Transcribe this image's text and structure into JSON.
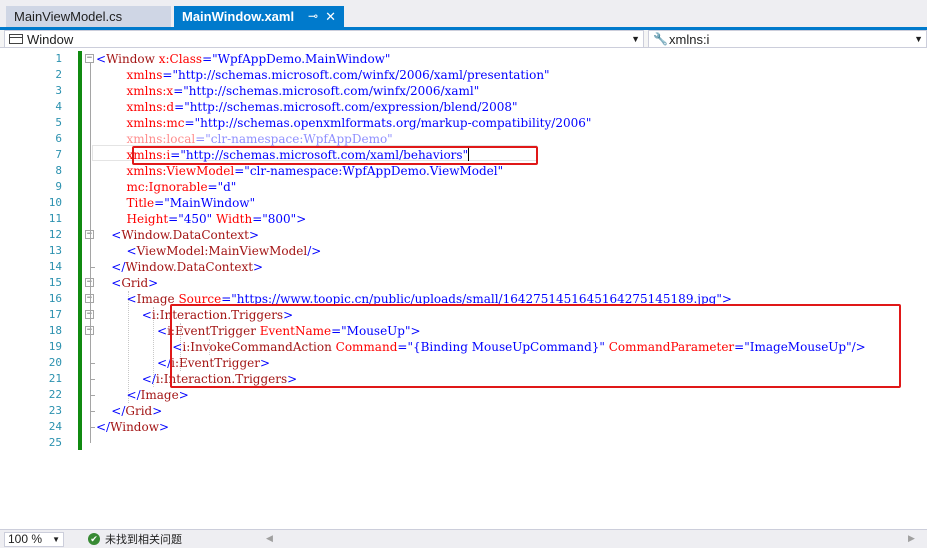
{
  "tabs": [
    {
      "label": "MainViewModel.cs",
      "active": false
    },
    {
      "label": "MainWindow.xaml",
      "active": true,
      "pin_icon": "pin-icon",
      "close_icon": "close-icon"
    }
  ],
  "tab_pin_glyph": "⊸",
  "tab_close_glyph": "✕",
  "navbar": {
    "left_value": "Window",
    "right_value": "xmlns:i",
    "left_icon": "class-icon",
    "right_icon": "wrench-icon",
    "dropdown_glyph": "▼"
  },
  "code_lines": [
    [
      [
        "p",
        "<"
      ],
      [
        "e",
        "Window "
      ],
      [
        "a",
        "x:Class"
      ],
      [
        "p",
        "="
      ],
      [
        "v",
        "\"WpfAppDemo.MainWindow\""
      ]
    ],
    [
      [
        "s",
        "        "
      ],
      [
        "a",
        "xmlns"
      ],
      [
        "p",
        "="
      ],
      [
        "v",
        "\"http://schemas.microsoft.com/winfx/2006/xaml/presentation\""
      ]
    ],
    [
      [
        "s",
        "        "
      ],
      [
        "a",
        "xmlns:x"
      ],
      [
        "p",
        "="
      ],
      [
        "v",
        "\"http://schemas.microsoft.com/winfx/2006/xaml\""
      ]
    ],
    [
      [
        "s",
        "        "
      ],
      [
        "a",
        "xmlns:d"
      ],
      [
        "p",
        "="
      ],
      [
        "v",
        "\"http://schemas.microsoft.com/expression/blend/2008\""
      ]
    ],
    [
      [
        "s",
        "        "
      ],
      [
        "a",
        "xmlns:mc"
      ],
      [
        "p",
        "="
      ],
      [
        "v",
        "\"http://schemas.openxmlformats.org/markup-compatibility/2006\""
      ]
    ],
    [
      [
        "s",
        "        "
      ],
      [
        "fa",
        "xmlns:local"
      ],
      [
        "fp",
        "="
      ],
      [
        "fv",
        "\"clr-namespace:WpfAppDemo\""
      ]
    ],
    [
      [
        "s",
        "        "
      ],
      [
        "a",
        "xmlns:i"
      ],
      [
        "p",
        "="
      ],
      [
        "v",
        "\"http://schemas.microsoft.com/xaml/behaviors\""
      ],
      [
        "c",
        ""
      ]
    ],
    [
      [
        "s",
        "        "
      ],
      [
        "a",
        "xmlns:ViewModel"
      ],
      [
        "p",
        "="
      ],
      [
        "v",
        "\"clr-namespace:WpfAppDemo.ViewModel\""
      ]
    ],
    [
      [
        "s",
        "        "
      ],
      [
        "a",
        "mc:Ignorable"
      ],
      [
        "p",
        "="
      ],
      [
        "v",
        "\"d\""
      ]
    ],
    [
      [
        "s",
        "        "
      ],
      [
        "a",
        "Title"
      ],
      [
        "p",
        "="
      ],
      [
        "v",
        "\"MainWindow\""
      ]
    ],
    [
      [
        "s",
        "        "
      ],
      [
        "a",
        "Height"
      ],
      [
        "p",
        "="
      ],
      [
        "v",
        "\"450\" "
      ],
      [
        "a",
        "Width"
      ],
      [
        "p",
        "="
      ],
      [
        "v",
        "\"800\""
      ],
      [
        "p",
        ">"
      ]
    ],
    [
      [
        "s",
        "    "
      ],
      [
        "p",
        "<"
      ],
      [
        "e",
        "Window.DataContext"
      ],
      [
        "p",
        ">"
      ]
    ],
    [
      [
        "s",
        "        "
      ],
      [
        "p",
        "<"
      ],
      [
        "e",
        "ViewModel:MainViewModel"
      ],
      [
        "p",
        "/>"
      ]
    ],
    [
      [
        "s",
        "    "
      ],
      [
        "p",
        "</"
      ],
      [
        "e",
        "Window.DataContext"
      ],
      [
        "p",
        ">"
      ]
    ],
    [
      [
        "s",
        "    "
      ],
      [
        "p",
        "<"
      ],
      [
        "e",
        "Grid"
      ],
      [
        "p",
        ">"
      ]
    ],
    [
      [
        "s",
        "        "
      ],
      [
        "p",
        "<"
      ],
      [
        "e",
        "Image "
      ],
      [
        "a",
        "Source"
      ],
      [
        "p",
        "="
      ],
      [
        "v",
        "\"https://www.toopic.cn/public/uploads/small/1642751451645164275145189.jpg\""
      ],
      [
        "p",
        ">"
      ]
    ],
    [
      [
        "s",
        "            "
      ],
      [
        "p",
        "<"
      ],
      [
        "e",
        "i:Interaction.Triggers"
      ],
      [
        "p",
        ">"
      ]
    ],
    [
      [
        "s",
        "                "
      ],
      [
        "p",
        "<"
      ],
      [
        "e",
        "i:EventTrigger "
      ],
      [
        "a",
        "EventName"
      ],
      [
        "p",
        "="
      ],
      [
        "v",
        "\"MouseUp\""
      ],
      [
        "p",
        ">"
      ]
    ],
    [
      [
        "s",
        "                    "
      ],
      [
        "p",
        "<"
      ],
      [
        "e",
        "i:InvokeCommandAction "
      ],
      [
        "a",
        "Command"
      ],
      [
        "p",
        "="
      ],
      [
        "v",
        "\"{Binding MouseUpCommand}\" "
      ],
      [
        "a",
        "CommandParameter"
      ],
      [
        "p",
        "="
      ],
      [
        "v",
        "\"ImageMouseUp\""
      ],
      [
        "p",
        "/>"
      ]
    ],
    [
      [
        "s",
        "                "
      ],
      [
        "p",
        "</"
      ],
      [
        "e",
        "i:EventTrigger"
      ],
      [
        "p",
        ">"
      ]
    ],
    [
      [
        "s",
        "            "
      ],
      [
        "p",
        "</"
      ],
      [
        "e",
        "i:Interaction.Triggers"
      ],
      [
        "p",
        ">"
      ]
    ],
    [
      [
        "s",
        "        "
      ],
      [
        "p",
        "</"
      ],
      [
        "e",
        "Image"
      ],
      [
        "p",
        ">"
      ]
    ],
    [
      [
        "s",
        "    "
      ],
      [
        "p",
        "</"
      ],
      [
        "e",
        "Grid"
      ],
      [
        "p",
        ">"
      ]
    ],
    [
      [
        "p",
        "</"
      ],
      [
        "e",
        "Window"
      ],
      [
        "p",
        ">"
      ]
    ],
    []
  ],
  "status": {
    "zoom": "100 %",
    "issues_text": "未找到相关问题",
    "issues_icon": "check-circle-icon",
    "check_glyph": "✔",
    "scroll_left_glyph": "◀",
    "scroll_right_glyph": "▶"
  },
  "colors": {
    "accent": "#007acc",
    "change_bar": "#108a10",
    "highlight_box": "#e01818",
    "line_numbers": "#2b91af",
    "xml_element": "#a31515",
    "xml_attribute": "#ff0000",
    "xml_value": "#0000ff"
  }
}
